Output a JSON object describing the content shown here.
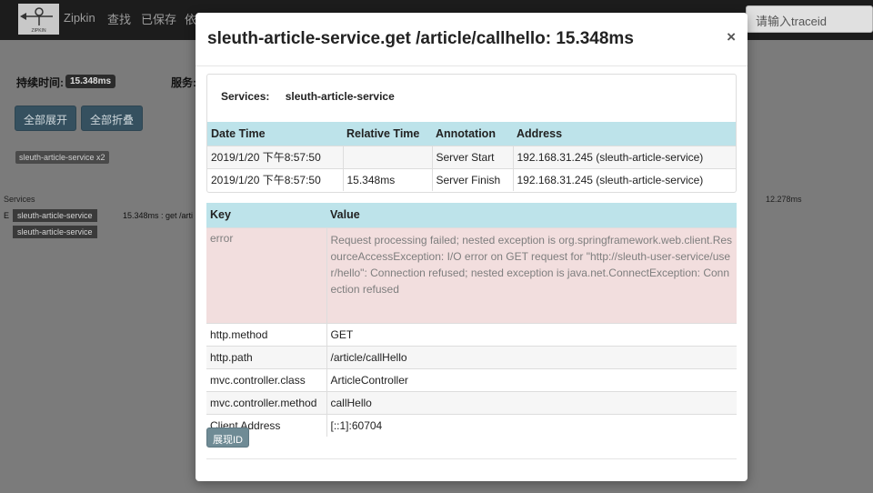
{
  "navbar": {
    "brand": "Zipkin",
    "logo_text": "ZIPKIN",
    "links": [
      "查找",
      "已保存",
      "依"
    ],
    "search_placeholder": "请输入traceid"
  },
  "background": {
    "duration_label": "持续时间:",
    "duration_value": "15.348ms",
    "services_label": "服务:",
    "expand_all": "全部展开",
    "collapse_all": "全部折叠",
    "service_tag": "sleuth-article-service x2",
    "services_header": "Services",
    "right_duration": "12.278ms",
    "tree_prefix": "E",
    "span_service_1": "sleuth-article-service",
    "span_service_2": "sleuth-article-service",
    "span_duration": "15.348ms : get /arti"
  },
  "modal": {
    "title": "sleuth-article-service.get /article/callhello: 15.348ms",
    "close": "×",
    "services_label": "Services:",
    "services_value": "sleuth-article-service",
    "annotations": {
      "headers": [
        "Date Time",
        "Relative Time",
        "Annotation",
        "Address"
      ],
      "rows": [
        [
          "2019/1/20 下午8:57:50",
          "",
          "Server Start",
          "192.168.31.245 (sleuth-article-service)"
        ],
        [
          "2019/1/20 下午8:57:50",
          "15.348ms",
          "Server Finish",
          "192.168.31.245 (sleuth-article-service)"
        ]
      ]
    },
    "tags": {
      "headers": [
        "Key",
        "Value"
      ],
      "rows": [
        [
          "error",
          "Request processing failed; nested exception is org.springframework.web.client.ResourceAccessException: I/O error on GET request for \"http://sleuth-user-service/user/hello\": Connection refused; nested exception is java.net.ConnectException: Connection refused"
        ],
        [
          "http.method",
          "GET"
        ],
        [
          "http.path",
          "/article/callHello"
        ],
        [
          "mvc.controller.class",
          "ArticleController"
        ],
        [
          "mvc.controller.method",
          "callHello"
        ],
        [
          "Client Address",
          "[::1]:60704"
        ]
      ]
    },
    "trace_button": "展现ID"
  }
}
